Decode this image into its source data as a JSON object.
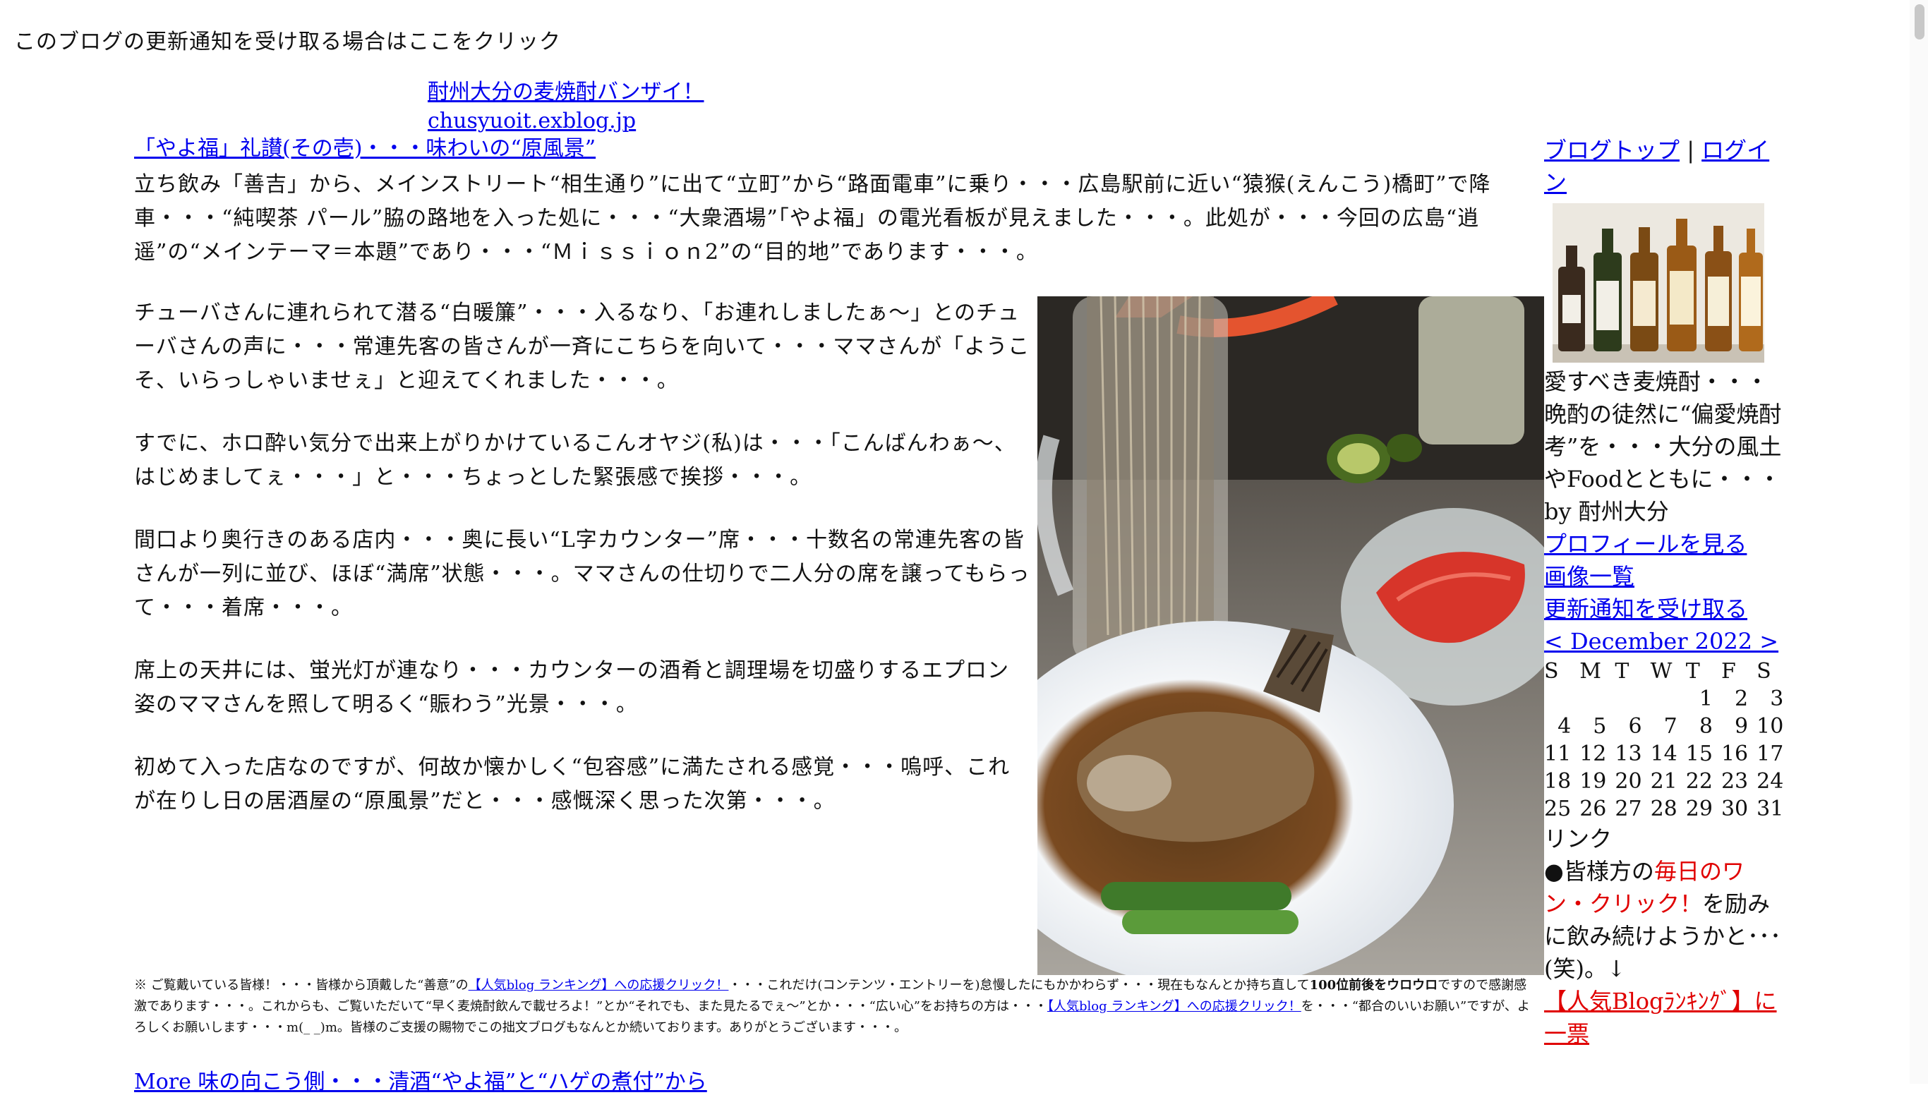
{
  "top_notice": "このブログの更新通知を受け取る場合はここをクリック",
  "blog": {
    "title": "酎州大分の麦焼酎バンザイ！",
    "url": "chusyuoit.exblog.jp"
  },
  "post": {
    "title": "「やよ福」礼讃(その壱)・・・味わいの“原風景”",
    "lead": "立ち飲み「善吉」から、メインストリート“相生通り”に出て“立町”から“路面電車”に乗り・・・広島駅前に近い“猿猴(えんこう)橋町”で降車・・・“純喫茶 パール”脇の路地を入った処に・・・“大衆酒場”「やよ福」の電光看板が見えました・・・。此処が・・・今回の広島“逍遥”の“メインテーマ＝本題”であり・・・“Ｍｉｓｓｉｏｎ2”の“目的地”であります・・・。",
    "paragraphs": [
      "チューバさんに連れられて潜る“白暖簾”・・・入るなり、「お連れしましたぁ～」とのチューバさんの声に・・・常連先客の皆さんが一斉にこちらを向いて・・・ママさんが「ようこそ、いらっしゃいませぇ」と迎えてくれました・・・。",
      "すでに、ホロ酔い気分で出来上がりかけているこんオヤジ(私)は・・・「こんばんわぁ～、はじめましてぇ・・・」と・・・ちょっとした緊張感で挨拶・・・。",
      "間口より奥行きのある店内・・・奥に長い“L字カウンター”席・・・十数名の常連先客の皆さんが一列に並び、ほぼ“満席”状態・・・。ママさんの仕切りで二人分の席を譲ってもらって・・・着席・・・。",
      "席上の天井には、蛍光灯が連なり・・・カウンターの酒肴と調理場を切盛りするエプロン姿のママさんを照して明るく“賑わう”光景・・・。",
      "初めて入った店なのですが、何故か懐かしく“包容感”に満たされる感覚・・・嗚呼、これが在りし日の居酒屋の“原風景”だと・・・感慨深く思った次第・・・。"
    ],
    "footnote": {
      "part1": "※ ご覧戴いている皆様！・・・皆様から頂戴した“善意”の",
      "link1": "【人気blog ランキング】への応援クリック！",
      "part2": "・・・これだけ(コンテンツ・エントリーを)怠慢したにもかかわらず・・・現在もなんとか持ち直して",
      "bold": "100位前後をウロウロ",
      "part3": "ですので感謝感激であります・・・。これからも、ご覧いただいて“早く麦焼酎飲んで載せろよ！”とか“それでも、また見たるでぇ～”とか・・・“広い心”をお持ちの方は・・・",
      "link2": "【人気blog ランキング】への応援クリック！",
      "part4": "を・・・“都合のいいお願い”ですが、よろしくお願いします・・・m(_ _)m。皆様のご支援の賜物でこの拙文ブログもなんとか続いております。ありがとうございます・・・。"
    },
    "more": "More 味の向こう側・・・清酒“やよ福”と“ハゲの煮付”から"
  },
  "sidebar": {
    "blog_top": "ブログトップ",
    "separator": "|",
    "login": "ログイン",
    "description": "愛すべき麦焼酎・・・晩酌の徒然に“偏愛焼酎考”を・・・大分の風土やFoodとともに・・・",
    "by": "by 酎州大分",
    "profile": "プロフィールを見る",
    "images": "画像一覧",
    "subscribe": "更新通知を受け取る",
    "cal_nav": "< December 2022 >",
    "calendar": {
      "headers": [
        "S",
        "M",
        "T",
        "W",
        "T",
        "F",
        "S"
      ],
      "weeks": [
        [
          "",
          "",
          "",
          "",
          "1",
          "2",
          "3"
        ],
        [
          "4",
          "5",
          "6",
          "7",
          "8",
          "9",
          "10"
        ],
        [
          "11",
          "12",
          "13",
          "14",
          "15",
          "16",
          "17"
        ],
        [
          "18",
          "19",
          "20",
          "21",
          "22",
          "23",
          "24"
        ],
        [
          "25",
          "26",
          "27",
          "28",
          "29",
          "30",
          "31"
        ]
      ]
    },
    "links_title": "リンク",
    "promo_prefix": "●皆様方の",
    "promo_red": "毎日のワン・クリック！",
    "promo_suffix": "を励みに飲み続けようかと･･･(笑)。↓",
    "ranking": "【人気Blogﾗﾝｷﾝｸﾞ】に一票"
  },
  "colors": {
    "link": "#0000ee",
    "accent_red": "#e00000",
    "background": "#ffffff"
  }
}
